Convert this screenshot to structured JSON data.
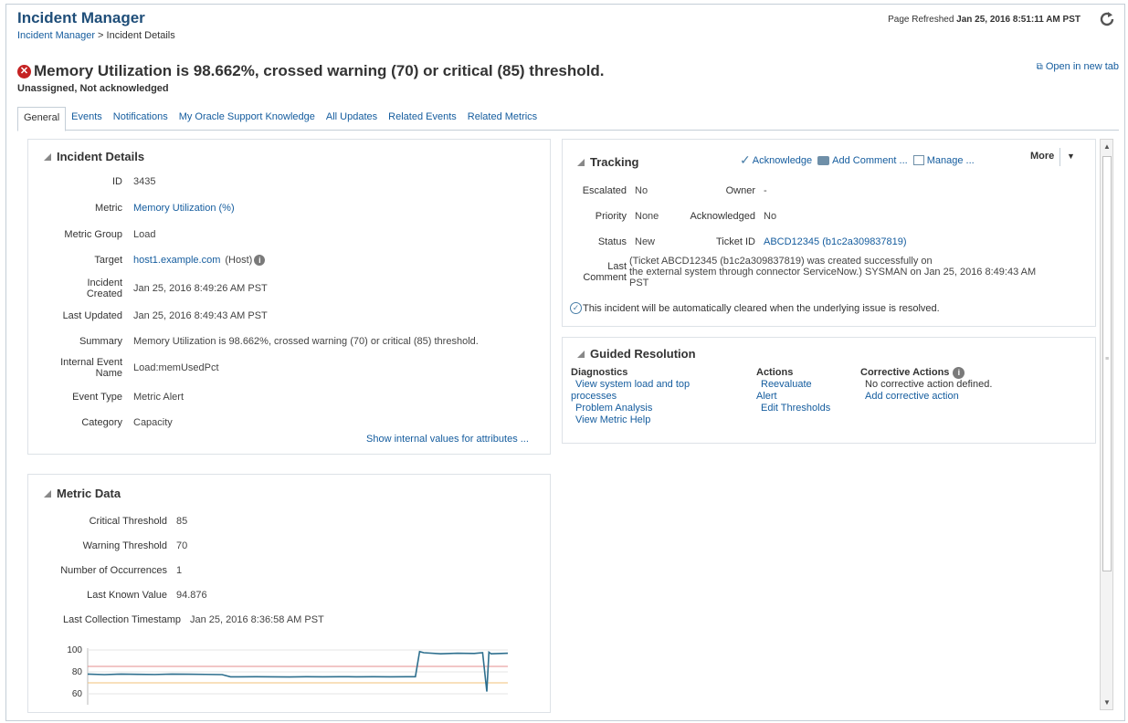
{
  "header": {
    "app_title": "Incident Manager",
    "breadcrumb_root": "Incident Manager",
    "breadcrumb_sep": " > ",
    "breadcrumb_current": "Incident Details",
    "refresh_prefix": "Page Refreshed ",
    "refresh_time": "Jan 25, 2016 8:51:11 AM PST",
    "refresh_icon": "refresh-icon",
    "open_new_tab": "Open in new tab"
  },
  "incident": {
    "title": "Memory Utilization is 98.662%, crossed warning (70) or critical (85) threshold.",
    "status_line": "Unassigned, Not acknowledged",
    "error_color": "#c52222"
  },
  "tabs": [
    {
      "label": "General",
      "active": true
    },
    {
      "label": "Events"
    },
    {
      "label": "Notifications"
    },
    {
      "label": "My Oracle Support Knowledge"
    },
    {
      "label": "All Updates"
    },
    {
      "label": "Related Events"
    },
    {
      "label": "Related Metrics"
    }
  ],
  "details": {
    "heading": "Incident Details",
    "id_label": "ID",
    "id_value": "3435",
    "metric_label": "Metric",
    "metric_value": "Memory Utilization (%)",
    "metric_group_label": "Metric Group",
    "metric_group_value": "Load",
    "target_label": "Target",
    "target_value": "host1.example.com",
    "target_type": "(Host)",
    "created_label_1": "Incident",
    "created_label_2": "Created",
    "created_value": "Jan 25, 2016 8:49:26 AM PST",
    "updated_label": "Last Updated",
    "updated_value": "Jan 25, 2016 8:49:43 AM PST",
    "summary_label": "Summary",
    "summary_value": "Memory Utilization is 98.662%, crossed warning (70) or critical (85) threshold.",
    "internal_label_1": "Internal Event",
    "internal_label_2": "Name",
    "internal_value": "Load:memUsedPct",
    "event_type_label": "Event Type",
    "event_type_value": "Metric Alert",
    "category_label": "Category",
    "category_value": "Capacity",
    "show_internal": "Show internal values for attributes ..."
  },
  "metric": {
    "heading": "Metric Data",
    "critical_label": "Critical Threshold",
    "critical_value": "85",
    "warning_label": "Warning Threshold",
    "warning_value": "70",
    "occurrences_label": "Number of Occurrences",
    "occurrences_value": "1",
    "last_value_label": "Last Known Value",
    "last_value_value": "94.876",
    "timestamp_label": "Last Collection Timestamp",
    "timestamp_value": "Jan 25, 2016 8:36:58 AM PST"
  },
  "tracking": {
    "heading": "Tracking",
    "acknowledge": "Acknowledge",
    "add_comment": "Add Comment ...",
    "manage": "Manage ...",
    "more": "More",
    "escalated_label": "Escalated",
    "escalated_value": "No",
    "owner_label": "Owner",
    "owner_value": "-",
    "priority_label": "Priority",
    "priority_value": "None",
    "acknowledged_label": "Acknowledged",
    "acknowledged_value": "No",
    "status_label": "Status",
    "status_value": "New",
    "ticket_label": "Ticket ID",
    "ticket_value": "ABCD12345 (b1c2a309837819)",
    "last_comment_label_1": "Last",
    "last_comment_label_2": "Comment",
    "last_comment_line1": "(Ticket  ABCD12345 (b1c2a309837819) was created successfully on",
    "last_comment_line2": "the external system through connector ServiceNow.) SYSMAN on Jan 25, 2016 8:49:43 AM",
    "last_comment_line3": "PST",
    "auto_clear": "This incident will be automatically cleared when the underlying issue is resolved."
  },
  "guided": {
    "heading": "Guided Resolution",
    "diagnostics_heading": "Diagnostics",
    "diag_link1_a": "View system load and top",
    "diag_link1_b": "processes",
    "diag_link2": "Problem Analysis",
    "diag_link3": "View Metric Help",
    "actions_heading": "Actions",
    "action_link1_a": "Reevaluate",
    "action_link1_b": "Alert",
    "action_link2": "Edit Thresholds",
    "corrective_heading": "Corrective Actions",
    "corrective_none": "No corrective action defined.",
    "corrective_add": "Add corrective action"
  },
  "chart_data": {
    "type": "line",
    "title": "",
    "y_ticks": [
      "100",
      "80",
      "60"
    ],
    "ylim": [
      50,
      100
    ],
    "thresholds": [
      {
        "name": "Critical Threshold",
        "value": 85,
        "color": "#e58c8c"
      },
      {
        "name": "Warning Threshold",
        "value": 70,
        "color": "#f0c27a"
      }
    ],
    "series": [
      {
        "color": "#2e6f8e",
        "x": [
          0,
          0.04,
          0.08,
          0.12,
          0.16,
          0.2,
          0.24,
          0.28,
          0.32,
          0.34,
          0.36,
          0.4,
          0.44,
          0.48,
          0.5,
          0.52,
          0.56,
          0.6,
          0.64,
          0.68,
          0.72,
          0.76,
          0.78,
          0.79,
          0.8,
          0.84,
          0.88,
          0.92,
          0.94,
          0.95,
          0.955,
          0.96,
          1.0
        ],
        "values": [
          78,
          77.5,
          78,
          77.8,
          77.6,
          78,
          77.9,
          77.7,
          77.5,
          75.5,
          75.5,
          75.6,
          75.5,
          75.4,
          75.5,
          75.6,
          75.5,
          75.6,
          75.5,
          75.6,
          75.5,
          75.6,
          75.6,
          98.5,
          97.5,
          96.5,
          97,
          96.8,
          97.5,
          62,
          98,
          96.5,
          97
        ]
      }
    ]
  }
}
